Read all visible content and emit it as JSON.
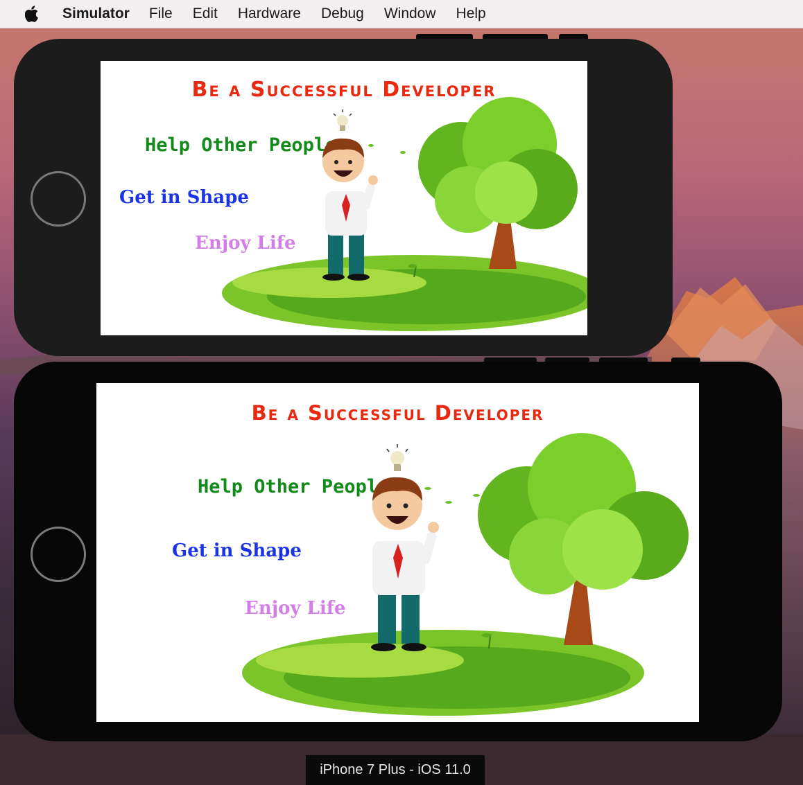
{
  "menubar": {
    "apple_icon": "apple-logo-icon",
    "items": [
      "Simulator",
      "File",
      "Edit",
      "Hardware",
      "Debug",
      "Window",
      "Help"
    ]
  },
  "app_screen": {
    "title": "Be a Successful Developer",
    "phrases": [
      "Help Other People",
      "Get in Shape",
      "Enjoy Life"
    ]
  },
  "device_label": "iPhone 7 Plus - iOS 11.0",
  "colors": {
    "title": "#e8290f",
    "help": "#118a1a",
    "shape": "#1b34e6",
    "enjoy": "#d17ee6"
  },
  "icons": [
    "apple-logo-icon",
    "lightbulb-icon",
    "home-button-icon"
  ]
}
